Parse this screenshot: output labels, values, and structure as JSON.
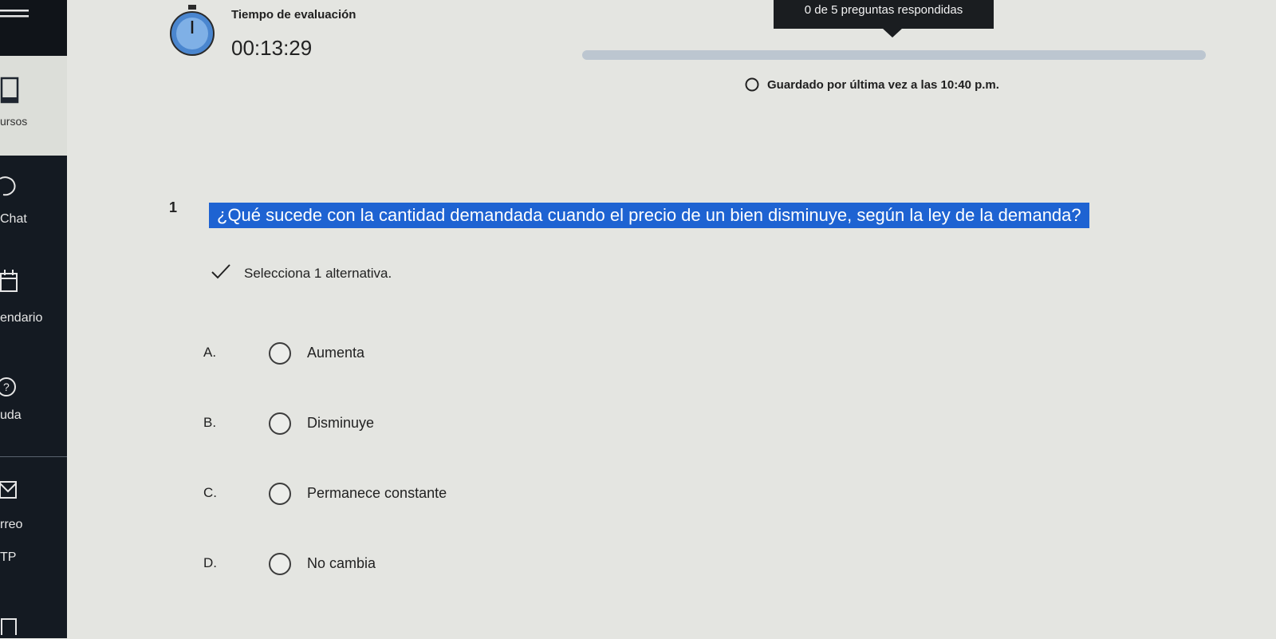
{
  "sidebar": {
    "items": [
      {
        "label": "ursos",
        "icon": "book-icon"
      },
      {
        "label": "Chat",
        "icon": "chat-bubble-icon"
      },
      {
        "label": "endario",
        "icon": "calendar-icon"
      },
      {
        "label": "uda",
        "icon": "help-circle-icon"
      },
      {
        "label": "rreo",
        "icon": "mail-icon"
      },
      {
        "label": "TP",
        "icon": "app-icon"
      }
    ]
  },
  "header": {
    "timer_title": "Tiempo de evaluación",
    "timer_value": "00:13:29",
    "progress_text": "0 de 5 preguntas respondidas",
    "progress_fraction": 0,
    "save_status": "Guardado por última vez a las 10:40 p.m."
  },
  "question": {
    "number": "1",
    "text": "¿Qué sucede con la cantidad demandada cuando el precio de un bien disminuye, según la ley de la demanda?",
    "instruction": "Selecciona 1 alternativa.",
    "options": [
      {
        "letter": "A.",
        "label": "Aumenta"
      },
      {
        "letter": "B.",
        "label": "Disminuye"
      },
      {
        "letter": "C.",
        "label": "Permanece constante"
      },
      {
        "letter": "D.",
        "label": "No cambia"
      }
    ]
  },
  "colors": {
    "sidebar": "#141a22",
    "highlight": "#1e63d2",
    "badge": "#1a1d20",
    "page": "#e4e5e1"
  }
}
